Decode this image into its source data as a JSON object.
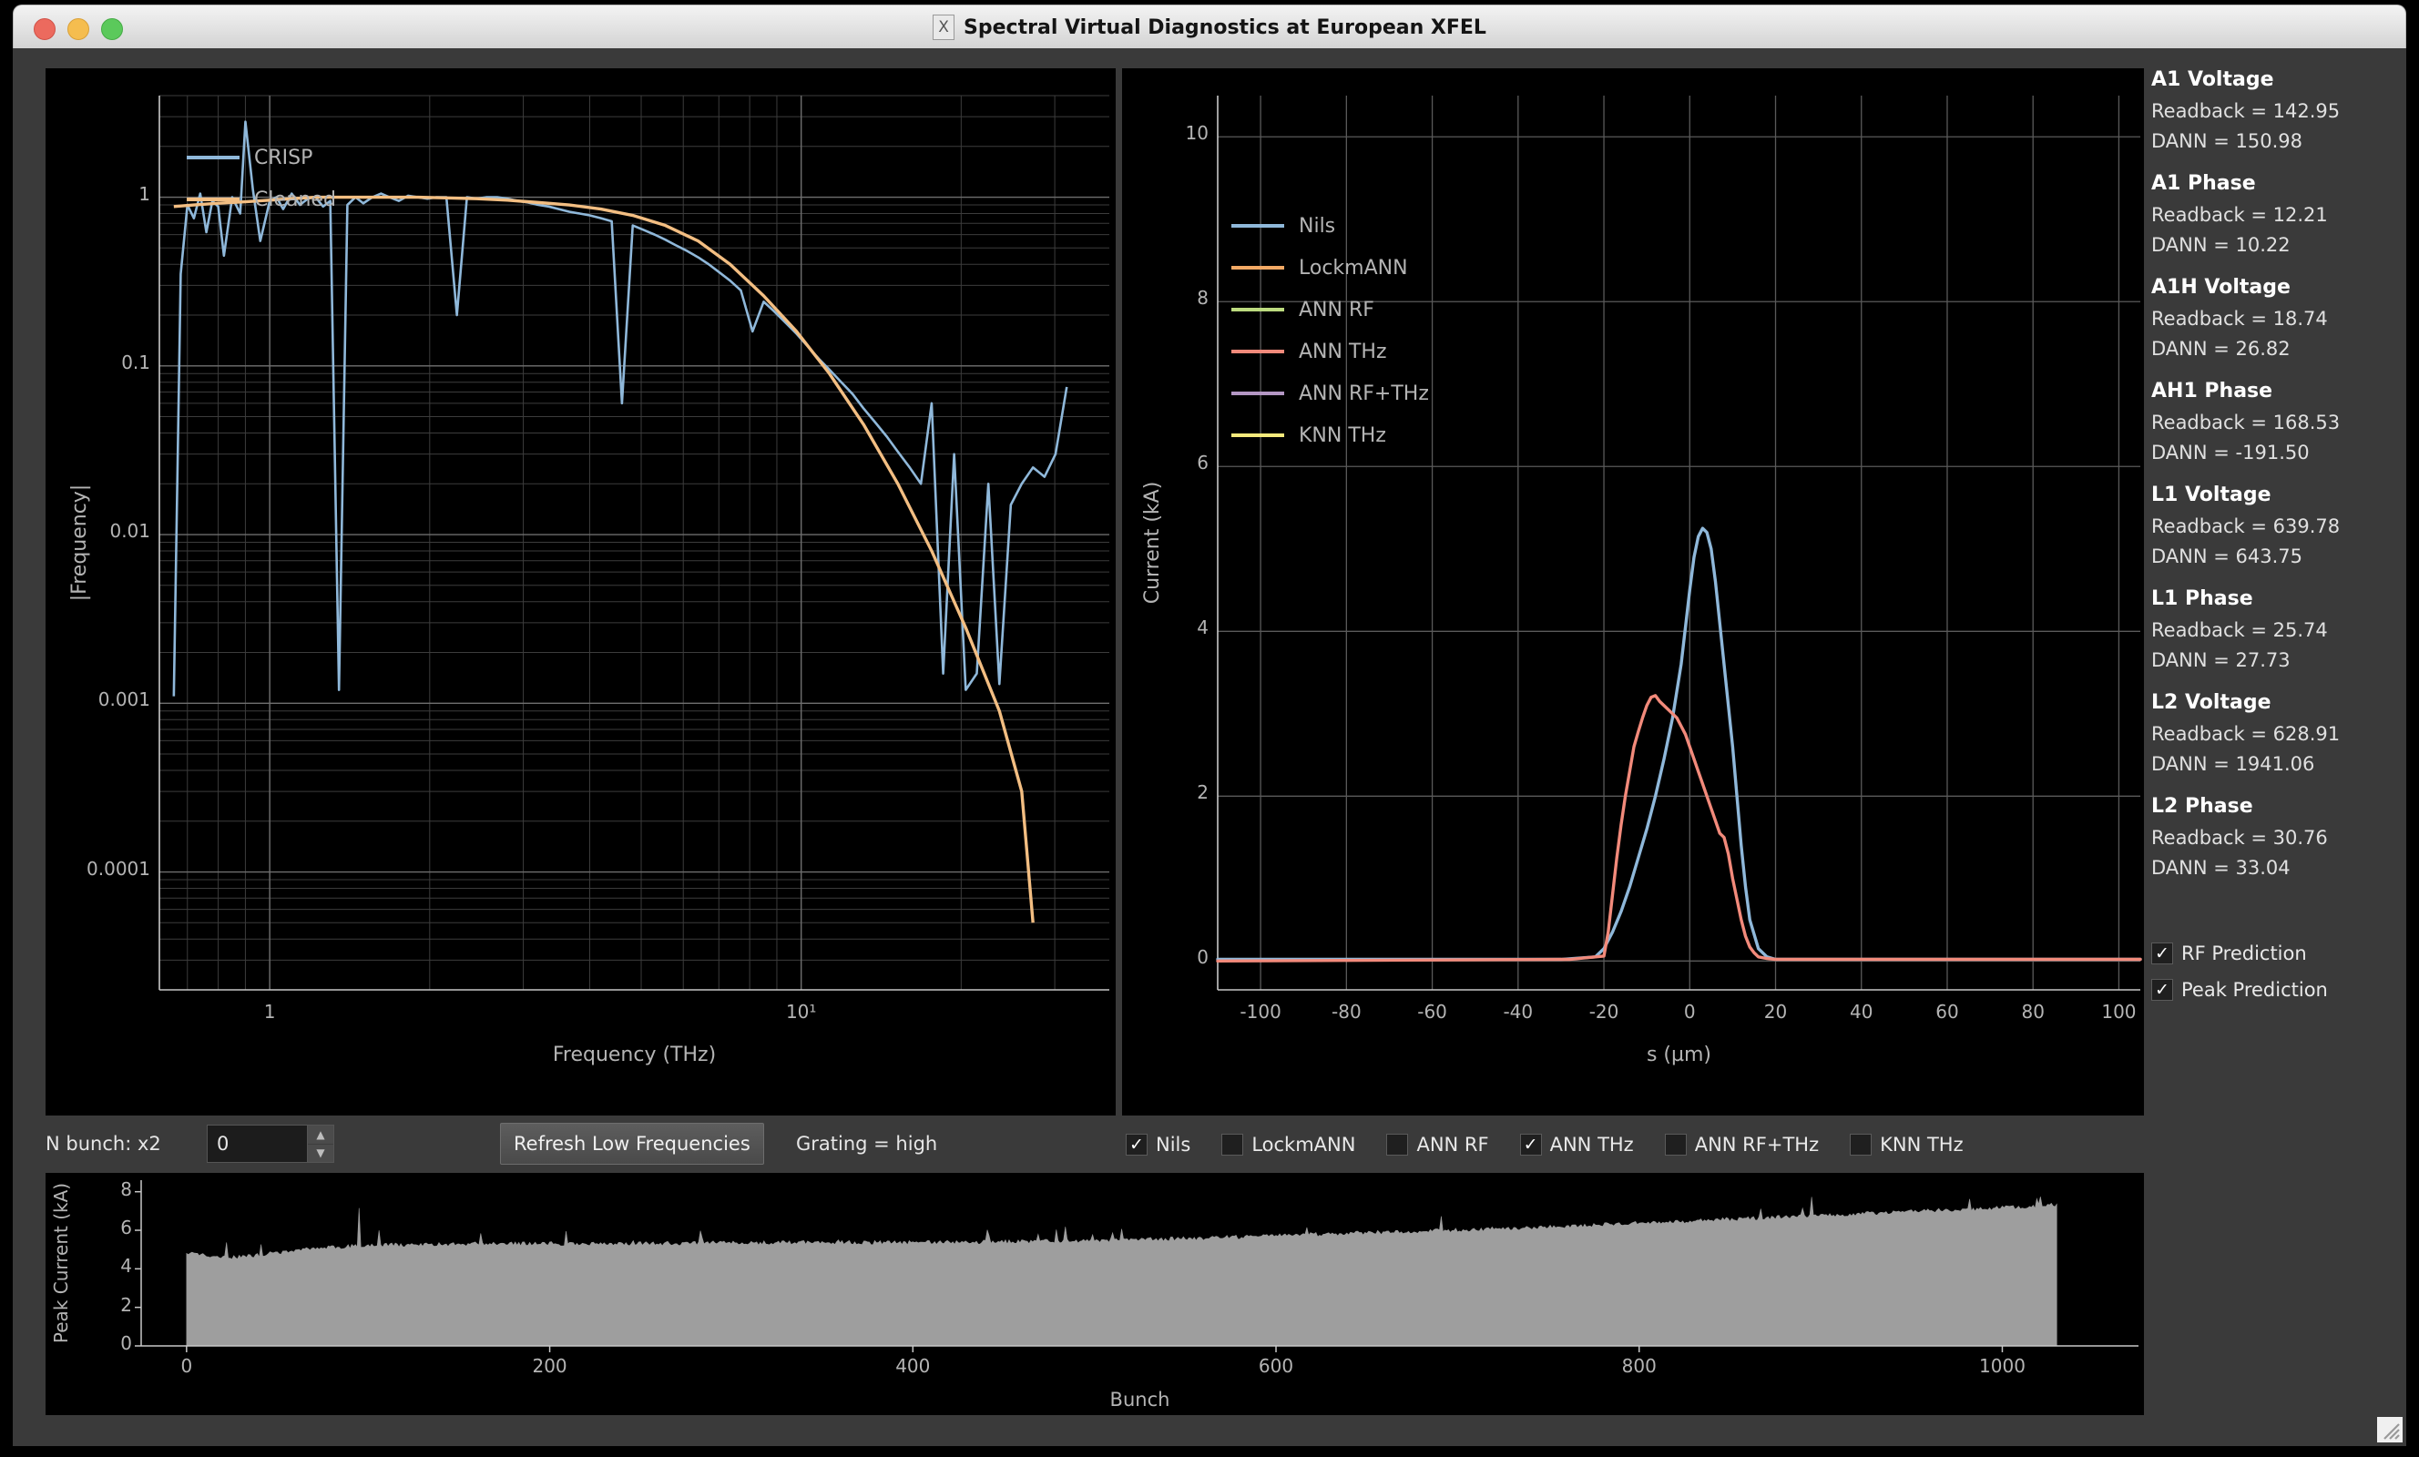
{
  "window": {
    "title": "Spectral Virtual Diagnostics at European XFEL",
    "app_icon": "x-logo-icon",
    "traffic_lights": [
      "close-button",
      "minimize-button",
      "maximize-button"
    ]
  },
  "colors": {
    "nils": "#8FB8DA",
    "lockmann": "#F3A965",
    "ann_rf": "#BCDB7F",
    "ann_thz": "#F28A7B",
    "ann_rf_thz": "#B497C4",
    "knn_thz": "#F4EA7C",
    "crisp": "#8FB8DA",
    "cleaned": "#F3BE82",
    "bunch_fill": "#9e9e9e",
    "grid": "#555555",
    "axis_text": "#b4b4b4"
  },
  "controls": {
    "n_bunch_label": "N bunch: x2",
    "n_bunch_value": "0",
    "spin_up": "▲",
    "spin_down": "▼",
    "refresh_button": "Refresh Low Frequencies",
    "grating_label": "Grating = high"
  },
  "series_checkboxes": [
    {
      "label": "Nils",
      "checked": true
    },
    {
      "label": "LockmANN",
      "checked": false
    },
    {
      "label": "ANN RF",
      "checked": false
    },
    {
      "label": "ANN THz",
      "checked": true
    },
    {
      "label": "ANN RF+THz",
      "checked": false
    },
    {
      "label": "KNN THz",
      "checked": false
    }
  ],
  "sidebar": {
    "groups": [
      {
        "title": "A1 Voltage",
        "readback": "Readback = 142.95",
        "dann": "DANN = 150.98"
      },
      {
        "title": "A1 Phase",
        "readback": "Readback = 12.21",
        "dann": "DANN = 10.22"
      },
      {
        "title": "A1H Voltage",
        "readback": "Readback = 18.74",
        "dann": "DANN = 26.82"
      },
      {
        "title": "AH1 Phase",
        "readback": "Readback = 168.53",
        "dann": "DANN = -191.50"
      },
      {
        "title": "L1 Voltage",
        "readback": "Readback = 639.78",
        "dann": "DANN = 643.75"
      },
      {
        "title": "L1 Phase",
        "readback": "Readback = 25.74",
        "dann": "DANN = 27.73"
      },
      {
        "title": "L2 Voltage",
        "readback": "Readback = 628.91",
        "dann": "DANN = 1941.06"
      },
      {
        "title": "L2 Phase",
        "readback": "Readback = 30.76",
        "dann": "DANN = 33.04"
      }
    ],
    "checkboxes": [
      {
        "label": "RF Prediction",
        "checked": true
      },
      {
        "label": "Peak Prediction",
        "checked": true
      }
    ]
  },
  "chart_data": [
    {
      "id": "spectrum",
      "type": "line",
      "title": "",
      "xlabel": "Frequency (THz)",
      "ylabel": "|Frequency|",
      "xscale": "log",
      "yscale": "log",
      "xlim": [
        0.62,
        38
      ],
      "ylim": [
        2e-05,
        4.0
      ],
      "xticks": [
        "1",
        "10¹"
      ],
      "xtickvals": [
        1,
        10
      ],
      "yticks": [
        "1",
        "0.1",
        "0.01",
        "0.001",
        "0.0001"
      ],
      "ytickvals": [
        1,
        0.1,
        0.01,
        0.001,
        0.0001
      ],
      "grid": true,
      "legend_position": "upper-left",
      "series": [
        {
          "name": "CRISP",
          "color": "#8FB8DA",
          "x": [
            0.66,
            0.68,
            0.7,
            0.72,
            0.74,
            0.76,
            0.78,
            0.8,
            0.82,
            0.85,
            0.88,
            0.9,
            0.93,
            0.96,
            1.0,
            1.03,
            1.06,
            1.1,
            1.14,
            1.18,
            1.22,
            1.26,
            1.3,
            1.35,
            1.4,
            1.45,
            1.5,
            1.56,
            1.62,
            1.68,
            1.75,
            1.82,
            1.9,
            1.98,
            2.06,
            2.15,
            2.25,
            2.35,
            2.45,
            2.56,
            2.68,
            2.8,
            2.93,
            3.06,
            3.2,
            3.35,
            3.5,
            3.66,
            3.83,
            4.0,
            4.2,
            4.4,
            4.6,
            4.82,
            5.05,
            5.3,
            5.55,
            5.8,
            6.1,
            6.4,
            6.7,
            7.0,
            7.35,
            7.7,
            8.1,
            8.5,
            8.9,
            9.35,
            9.8,
            10.3,
            10.8,
            11.3,
            11.9,
            12.5,
            13.1,
            13.8,
            14.5,
            15.2,
            16.0,
            16.8,
            17.6,
            18.5,
            19.4,
            20.4,
            21.4,
            22.5,
            23.6,
            24.8,
            26.0,
            27.3,
            28.7,
            30.1,
            31.6
          ],
          "y": [
            0.0011,
            0.35,
            0.9,
            0.75,
            1.05,
            0.62,
            0.95,
            0.88,
            0.45,
            1.0,
            0.8,
            2.8,
            1.1,
            0.55,
            0.95,
            1.0,
            0.85,
            1.05,
            0.9,
            0.98,
            1.0,
            0.88,
            0.95,
            0.0012,
            0.9,
            1.0,
            0.92,
            1.0,
            1.05,
            1.0,
            0.95,
            1.02,
            1.0,
            0.98,
            1.0,
            1.0,
            0.2,
            1.0,
            0.98,
            1.0,
            1.0,
            0.98,
            0.95,
            0.93,
            0.9,
            0.88,
            0.85,
            0.82,
            0.8,
            0.78,
            0.75,
            0.72,
            0.06,
            0.68,
            0.64,
            0.6,
            0.56,
            0.52,
            0.48,
            0.44,
            0.4,
            0.36,
            0.32,
            0.28,
            0.16,
            0.24,
            0.21,
            0.18,
            0.155,
            0.13,
            0.11,
            0.095,
            0.08,
            0.068,
            0.056,
            0.046,
            0.038,
            0.031,
            0.025,
            0.02,
            0.06,
            0.0015,
            0.03,
            0.0012,
            0.0015,
            0.02,
            0.0013,
            0.015,
            0.02,
            0.025,
            0.022,
            0.03,
            0.075
          ]
        },
        {
          "name": "Cleaned",
          "color": "#F3BE82",
          "x": [
            0.66,
            0.72,
            0.8,
            0.9,
            1.0,
            1.1,
            1.22,
            1.35,
            1.5,
            1.68,
            1.9,
            2.15,
            2.45,
            2.8,
            3.2,
            3.66,
            4.2,
            4.82,
            5.55,
            6.4,
            7.35,
            8.5,
            9.8,
            11.3,
            13.1,
            15.2,
            17.6,
            20.4,
            23.6,
            26.0,
            27.3
          ],
          "y": [
            0.88,
            0.9,
            0.92,
            0.94,
            0.96,
            0.98,
            1.0,
            1.0,
            1.0,
            1.0,
            1.0,
            0.99,
            0.98,
            0.96,
            0.93,
            0.9,
            0.85,
            0.78,
            0.68,
            0.55,
            0.4,
            0.26,
            0.16,
            0.09,
            0.045,
            0.02,
            0.008,
            0.0028,
            0.0009,
            0.0003,
            5e-05
          ]
        }
      ]
    },
    {
      "id": "current-profile",
      "type": "line",
      "title": "",
      "xlabel": "s (µm)",
      "ylabel": "Current (kA)",
      "xlim": [
        -110,
        105
      ],
      "ylim": [
        -0.35,
        10.5
      ],
      "xticks": [
        "-100",
        "-80",
        "-60",
        "-40",
        "-20",
        "0",
        "20",
        "40",
        "60",
        "80",
        "100"
      ],
      "xtickvals": [
        -100,
        -80,
        -60,
        -40,
        -20,
        0,
        20,
        40,
        60,
        80,
        100
      ],
      "yticks": [
        "0",
        "2",
        "4",
        "6",
        "8",
        "10"
      ],
      "ytickvals": [
        0,
        2,
        4,
        6,
        8,
        10
      ],
      "grid": true,
      "legend_position": "upper-left",
      "legend_entries": [
        "Nils",
        "LockmANN",
        "ANN RF",
        "ANN THz",
        "ANN RF+THz",
        "KNN THz"
      ],
      "series": [
        {
          "name": "Nils",
          "color": "#8FB8DA",
          "visible": true,
          "x": [
            -110,
            -30,
            -22,
            -20,
            -18,
            -16,
            -14,
            -12,
            -10,
            -8,
            -6,
            -4,
            -2,
            0,
            1,
            2,
            3,
            4,
            5,
            6,
            7,
            8,
            9,
            10,
            11,
            12,
            13,
            14,
            16,
            18,
            20,
            22,
            105
          ],
          "y": [
            0.02,
            0.02,
            0.05,
            0.15,
            0.35,
            0.6,
            0.9,
            1.25,
            1.6,
            2.0,
            2.45,
            2.95,
            3.6,
            4.5,
            4.9,
            5.15,
            5.25,
            5.2,
            5.0,
            4.6,
            4.1,
            3.6,
            3.1,
            2.6,
            2.0,
            1.4,
            0.9,
            0.5,
            0.15,
            0.05,
            0.02,
            0.02,
            0.02
          ]
        },
        {
          "name": "ANN THz",
          "color": "#F28A7B",
          "visible": true,
          "x": [
            -110,
            -28,
            -24,
            -22,
            -20,
            -19,
            -18,
            -17,
            -16,
            -15,
            -14,
            -13,
            -12,
            -11,
            -10,
            -9,
            -8,
            -7,
            -6,
            -5,
            -4,
            -3,
            -2,
            -1,
            0,
            1,
            2,
            3,
            4,
            5,
            6,
            7,
            8,
            9,
            10,
            11,
            12,
            13,
            14,
            15,
            16,
            18,
            20,
            23,
            105
          ],
          "y": [
            0.0,
            0.02,
            0.04,
            0.05,
            0.06,
            0.35,
            0.8,
            1.25,
            1.65,
            2.0,
            2.3,
            2.6,
            2.78,
            2.95,
            3.1,
            3.2,
            3.22,
            3.15,
            3.1,
            3.05,
            3.0,
            2.95,
            2.85,
            2.75,
            2.6,
            2.45,
            2.3,
            2.15,
            2.0,
            1.85,
            1.7,
            1.55,
            1.5,
            1.3,
            1.0,
            0.75,
            0.5,
            0.3,
            0.17,
            0.1,
            0.05,
            0.03,
            0.02,
            0.02,
            0.02
          ]
        },
        {
          "name": "LockmANN",
          "color": "#F3A965",
          "visible": false,
          "x": [],
          "y": []
        },
        {
          "name": "ANN RF",
          "color": "#BCDB7F",
          "visible": false,
          "x": [],
          "y": []
        },
        {
          "name": "ANN RF+THz",
          "color": "#B497C4",
          "visible": false,
          "x": [],
          "y": []
        },
        {
          "name": "KNN THz",
          "color": "#F4EA7C",
          "visible": false,
          "x": [],
          "y": []
        }
      ]
    },
    {
      "id": "bunch-train",
      "type": "area",
      "title": "",
      "xlabel": "Bunch",
      "ylabel": "Peak Current (kA)",
      "xlim": [
        -25,
        1075
      ],
      "ylim": [
        0,
        8.6
      ],
      "xticks": [
        "0",
        "200",
        "400",
        "600",
        "800",
        "1000"
      ],
      "xtickvals": [
        0,
        200,
        400,
        600,
        800,
        1000
      ],
      "yticks": [
        "0",
        "2",
        "4",
        "6",
        "8"
      ],
      "ytickvals": [
        0,
        2,
        4,
        6,
        8
      ],
      "grid": false,
      "fill_color": "#9e9e9e",
      "n_bunches": 1030,
      "baseline_profile": {
        "description": "Peak current per bunch, noisy rising trend from ~4.8 kA at bunch 0 to ~7.3 kA at bunch 1030",
        "x": [
          0,
          20,
          40,
          60,
          80,
          100,
          140,
          180,
          220,
          260,
          300,
          350,
          400,
          450,
          500,
          550,
          600,
          650,
          700,
          750,
          800,
          850,
          900,
          950,
          1000,
          1030
        ],
        "y": [
          4.85,
          4.55,
          4.7,
          4.95,
          5.1,
          5.2,
          5.25,
          5.3,
          5.28,
          5.3,
          5.33,
          5.35,
          5.35,
          5.38,
          5.45,
          5.55,
          5.7,
          5.85,
          6.0,
          6.15,
          6.35,
          6.55,
          6.75,
          6.95,
          7.15,
          7.3
        ]
      }
    }
  ]
}
